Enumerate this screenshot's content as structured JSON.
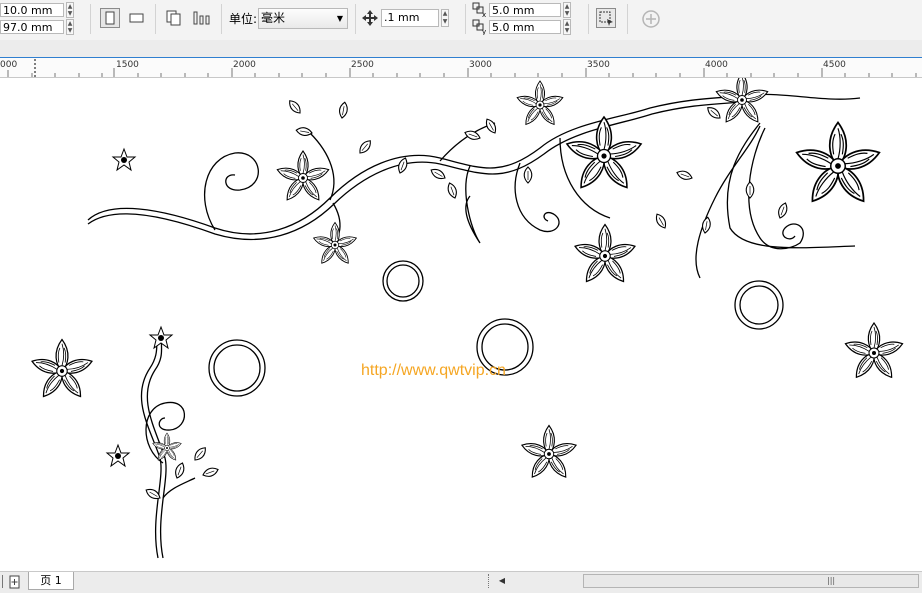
{
  "toolbar": {
    "width_value": "10.0 mm",
    "height_value": "97.0 mm",
    "unit_label": "单位:",
    "unit_selected": "毫米",
    "nudge_value": ".1 mm",
    "dup_x_value": "5.0 mm",
    "dup_y_value": "5.0 mm"
  },
  "ruler": {
    "ticks": [
      "1500",
      "2000",
      "2500",
      "3000",
      "3500",
      "4000",
      "4500"
    ],
    "left_label": "000"
  },
  "canvas": {
    "watermark": "http://www.qwtvip.cn"
  },
  "statusbar": {
    "page_tab": "页 1"
  },
  "colors": {
    "watermark": "#f5a623",
    "ruler_border": "#2f7fd0"
  }
}
